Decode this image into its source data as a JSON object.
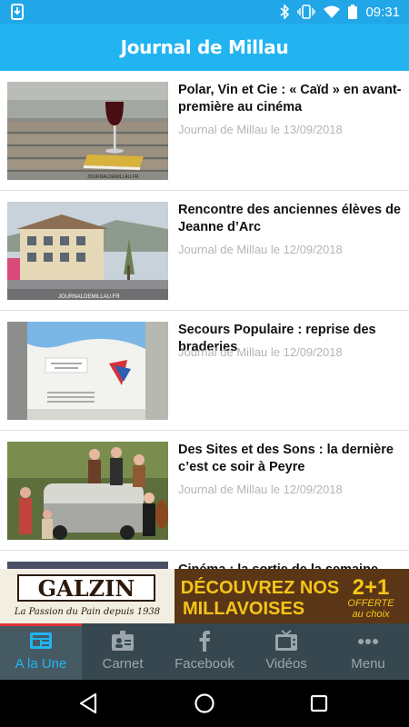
{
  "status_bar": {
    "time": "09:31",
    "icons": [
      "download-icon",
      "bluetooth-icon",
      "vibrate-icon",
      "wifi-icon",
      "battery-icon"
    ]
  },
  "app_bar": {
    "title": "Journal de Millau"
  },
  "articles": [
    {
      "title": "Polar, Vin et Cie : « Caïd » en avant-première au cinéma",
      "meta": "Journal de Millau le 13/09/2018",
      "thumb_caption": "JOURNALDEMILLAU.FR"
    },
    {
      "title": "Rencontre des anciennes élèves de Jeanne d’Arc",
      "meta": "Journal de Millau le 12/09/2018",
      "thumb_caption": "JOURNALDEMILLAU.FR"
    },
    {
      "title": "Secours Populaire : reprise des braderies",
      "meta": "Journal de Millau le 12/09/2018",
      "thumb_caption": ""
    },
    {
      "title": "Des Sites et des Sons : la dernière c’est ce soir à Peyre",
      "meta": "Journal de Millau le 12/09/2018",
      "thumb_caption": ""
    },
    {
      "title": "Cinéma : la sortie de la semaine",
      "meta": "",
      "thumb_caption": ""
    }
  ],
  "ad": {
    "brand": "GALZIN",
    "tagline": "La Passion du Pain depuis 1938",
    "headline_1": "DÉCOUVREZ NOS",
    "headline_2": "MILLAVOISES",
    "offer_main": "2+1",
    "offer_sub_1": "OFFERTE",
    "offer_sub_2": "au choix",
    "colors": {
      "background": "#5a3617",
      "text": "#f5c518",
      "brand_box": "#f3eee2"
    }
  },
  "tabs": [
    {
      "label": "A la Une",
      "icon": "newspaper-icon",
      "active": true
    },
    {
      "label": "Carnet",
      "icon": "id-card-icon",
      "active": false
    },
    {
      "label": "Facebook",
      "icon": "facebook-icon",
      "active": false
    },
    {
      "label": "Vidéos",
      "icon": "tv-icon",
      "active": false
    },
    {
      "label": "Menu",
      "icon": "more-dots-icon",
      "active": false
    }
  ],
  "colors": {
    "app_bar": "#21b4f0",
    "status_bar": "#21a7e8",
    "tab_bar": "#37474f",
    "tab_active": "#21b4f0",
    "tab_indicator": "#e0333b"
  }
}
